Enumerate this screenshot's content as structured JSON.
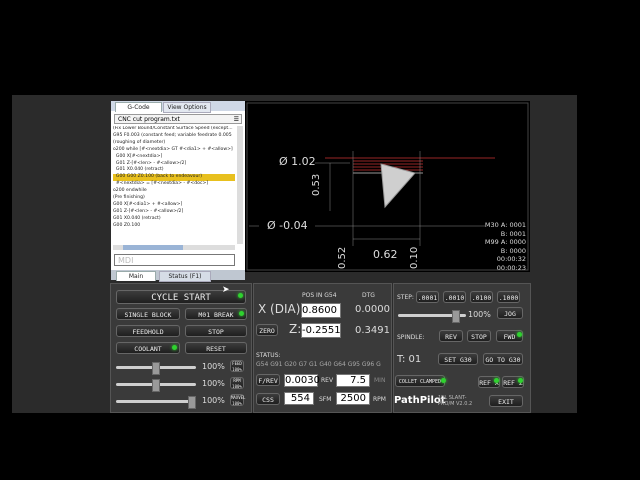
{
  "editor": {
    "tabs": [
      "G-Code",
      "View Options"
    ],
    "file_name": "CNC cut program.txt",
    "code_lines": [
      "(Fix Lower Bound/Constant Surface Speed (except...",
      "G95 F0.003 (constant feed; variable feedrate 0.005",
      "",
      "(roughing of diameter)",
      "o200 while [#<nextdia> GT #<dia1> + #<allow>]",
      "  G00 X[#<nextdia>]",
      "  G01 Z-[#<len> - #<allow>/2]",
      "  G01 X0.040 (retract)",
      "  G00 G00 Z0.100 (back to endeavour)",
      "  #<nextdia> = [#<nextdia> - #<doc>]",
      "o200 endwhile",
      "",
      "(Pre finishing)",
      "G00 X[#<dia1> + #<allow>]",
      "G01 Z-[#<len> - #<allow>/2]",
      "G01 X0.040 (retract)",
      "G00 Z0.100"
    ],
    "highlight_line": 8,
    "mdi_placeholder": "MDI",
    "bottom_tabs": [
      "Main",
      "Status (F1)"
    ]
  },
  "plot": {
    "dims": [
      "Ø 1.02",
      "0.53",
      "Ø -0.04",
      "0.62",
      "0.52",
      "0.10"
    ],
    "info": [
      "M30 A: 0001",
      "B: 0001",
      "M99 A: 0000",
      "B: 0000",
      "00:00:32",
      "00:00:23"
    ]
  },
  "left": {
    "cycle_start": "CYCLE START",
    "single_block": "SINGLE BLOCK",
    "m01_break": "M01 BREAK",
    "feedhold": "FEEDHOLD",
    "stop": "STOP",
    "coolant": "COOLANT",
    "reset": "RESET",
    "overrides": [
      {
        "value": "100%",
        "label": "FEED 100%",
        "level": 0.5
      },
      {
        "value": "100%",
        "label": "RPM 100%",
        "level": 0.5
      },
      {
        "value": "100%",
        "label": "MAXVEL 100%",
        "level": 1.0
      }
    ]
  },
  "dro": {
    "title": "POS IN G54",
    "dtg_title": "DTG",
    "x_label": "X (DIA):",
    "x_value": "0.8600",
    "x_dtg": "0.0000",
    "z_label": "Z:",
    "z_value": "-0.2551",
    "z_dtg": "0.3491",
    "zero": "ZERO",
    "status_label": "STATUS:",
    "status_text": "G54 G91 G20 G7 G1 G40 G64 G95 G96 G",
    "frev": "F/REV",
    "frev_value": "0.0030",
    "rev_label": "REV",
    "rev_value": "7.5",
    "min_label": "MIN",
    "css": "CSS",
    "sfm_value": "554",
    "sfm_label": "SFM",
    "rpm_value": "2500",
    "rpm_label": "RPM"
  },
  "right": {
    "step_label": "STEP:",
    "steps": [
      ".0001",
      ".0010",
      ".0100",
      ".1000"
    ],
    "jog_pct": "100%",
    "jog": "JOG",
    "spindle_label": "SPINDLE:",
    "rev": "REV",
    "stop": "STOP",
    "fwd": "FWD",
    "tool": "T: 01",
    "set_g30": "SET G30",
    "goto_g30": "GO TO G30",
    "collet": "COLLET CLAMPED",
    "ref_x": "REF X",
    "ref_z": "REF Z",
    "brand": "PathPilot",
    "model": "15L SLANT-PRO/M V2.0.2",
    "exit": "EXIT"
  }
}
